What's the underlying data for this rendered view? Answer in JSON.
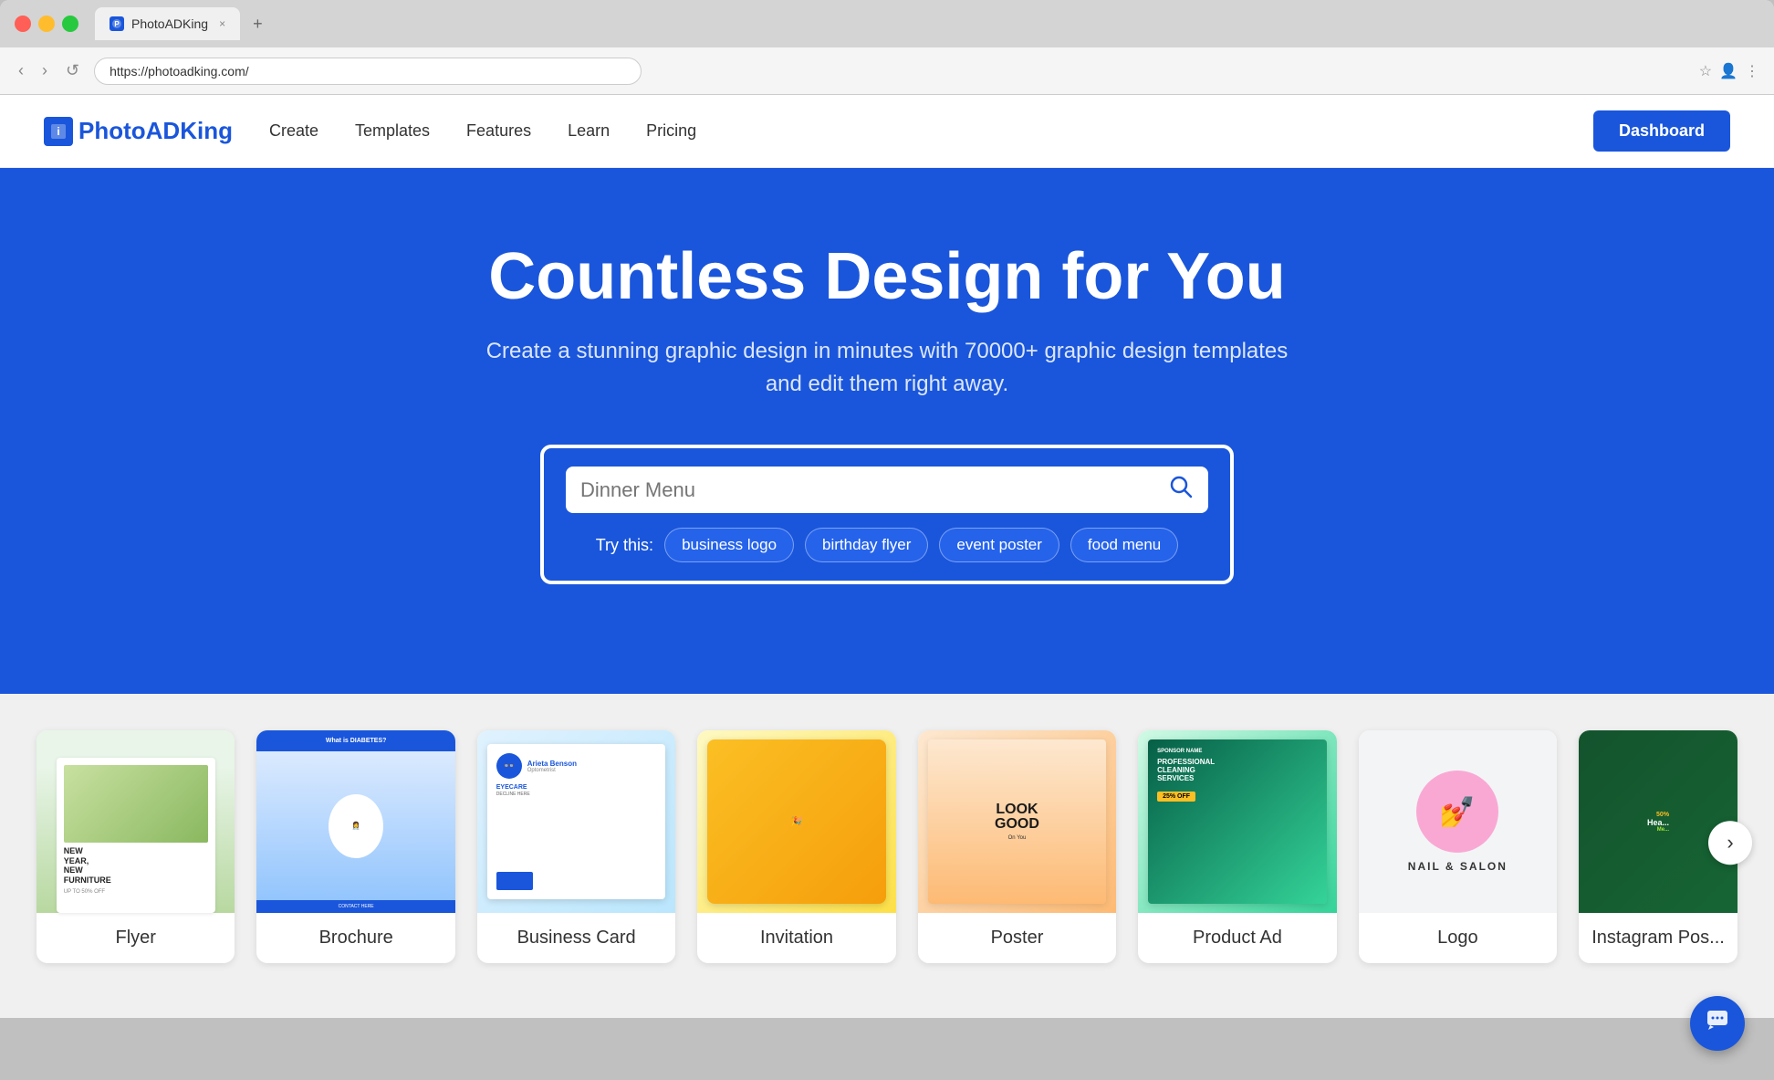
{
  "browser": {
    "url": "https://photoadking.com/",
    "tab_title": "PhotoADKing",
    "tab_new_label": "+",
    "tab_close_label": "×",
    "nav_back": "‹",
    "nav_forward": "›",
    "nav_refresh": "↺",
    "bookmark_icon": "☆",
    "profile_icon": "👤",
    "menu_icon": "⋮"
  },
  "header": {
    "logo_icon_text": "i",
    "logo_text": "PhotoADKing",
    "nav": [
      {
        "label": "Create"
      },
      {
        "label": "Templates"
      },
      {
        "label": "Features"
      },
      {
        "label": "Learn"
      },
      {
        "label": "Pricing"
      }
    ],
    "dashboard_btn": "Dashboard"
  },
  "hero": {
    "title": "Countless Design for You",
    "subtitle": "Create a stunning graphic design in minutes with 70000+ graphic design templates\nand edit them right away.",
    "search_placeholder": "Dinner Menu",
    "try_label": "Try this:",
    "try_tags": [
      {
        "label": "business logo"
      },
      {
        "label": "birthday flyer"
      },
      {
        "label": "event poster"
      },
      {
        "label": "food menu"
      }
    ]
  },
  "templates": {
    "carousel_next": "›",
    "items": [
      {
        "label": "Flyer"
      },
      {
        "label": "Brochure"
      },
      {
        "label": "Business Card"
      },
      {
        "label": "Invitation"
      },
      {
        "label": "Poster"
      },
      {
        "label": "Product Ad"
      },
      {
        "label": "Logo"
      },
      {
        "label": "Instagram Pos..."
      }
    ]
  },
  "chat": {
    "icon": "💬"
  },
  "colors": {
    "brand_blue": "#1a56db",
    "white": "#ffffff",
    "bg_gray": "#f0f0f0"
  }
}
